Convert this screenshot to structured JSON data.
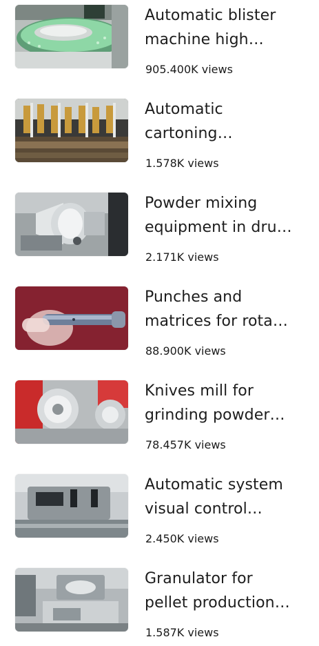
{
  "videos": [
    {
      "title_line1": "Automatic blister",
      "title_line2": "machine high…",
      "views": "905.400K",
      "views_label": "views"
    },
    {
      "title_line1": "Automatic",
      "title_line2": "cartoning…",
      "views": "1.578K",
      "views_label": "views"
    },
    {
      "title_line1": "Powder mixing",
      "title_line2": "equipment in dru…",
      "views": "2.171K",
      "views_label": "views"
    },
    {
      "title_line1": "Punches and",
      "title_line2": "matrices for rota…",
      "views": "88.900K",
      "views_label": "views"
    },
    {
      "title_line1": "Knives mill for",
      "title_line2": "grinding powder…",
      "views": "78.457K",
      "views_label": "views"
    },
    {
      "title_line1": "Automatic system",
      "title_line2": "visual control…",
      "views": "2.450K",
      "views_label": "views"
    },
    {
      "title_line1": "Granulator for",
      "title_line2": "pellet production…",
      "views": "1.587K",
      "views_label": "views"
    }
  ]
}
